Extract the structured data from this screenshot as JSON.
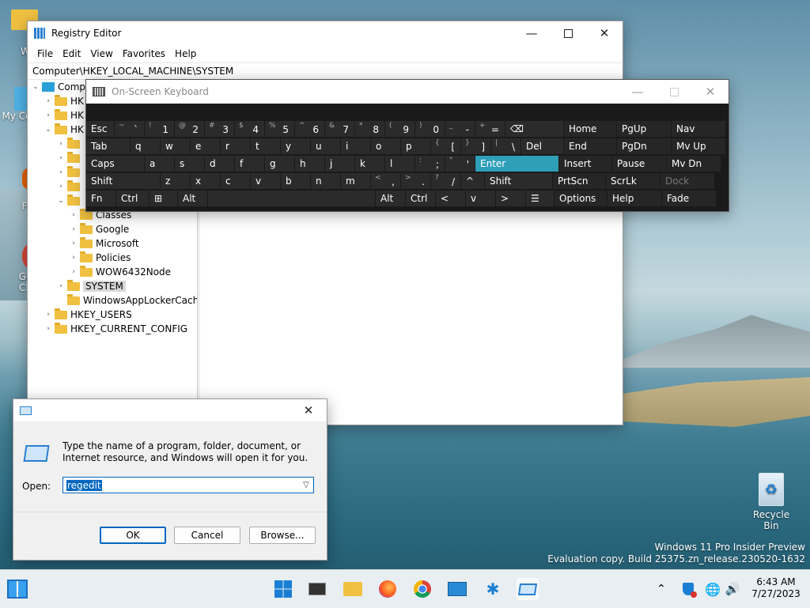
{
  "desktop": {
    "icons": [
      {
        "label": "W",
        "icon": "folder-icon"
      },
      {
        "label": "My Co",
        "icon": "computer-icon"
      },
      {
        "label": "Fi",
        "icon": "firefox-icon"
      },
      {
        "label": "Go",
        "label2": "Ch",
        "icon": "chrome-icon"
      },
      {
        "label": "Recycle Bin",
        "icon": "recycle-bin-icon"
      }
    ],
    "watermark_line1": "Windows 11 Pro Insider Preview",
    "watermark_line2": "Evaluation copy. Build 25375.zn_release.230520-1632"
  },
  "regedit": {
    "title": "Registry Editor",
    "menu": [
      "File",
      "Edit",
      "View",
      "Favorites",
      "Help"
    ],
    "address": "Computer\\HKEY_LOCAL_MACHINE\\SYSTEM",
    "tree": [
      {
        "label": "Comp",
        "level": 0,
        "chev": "v"
      },
      {
        "label": "HK",
        "level": 1,
        "chev": ">"
      },
      {
        "label": "HK",
        "level": 1,
        "chev": ">"
      },
      {
        "label": "HK",
        "level": 1,
        "chev": "v"
      },
      {
        "label": "Classes",
        "level": 3,
        "chev": ">"
      },
      {
        "label": "Google",
        "level": 3,
        "chev": ">"
      },
      {
        "label": "Microsoft",
        "level": 3,
        "chev": ">"
      },
      {
        "label": "Policies",
        "level": 3,
        "chev": ">"
      },
      {
        "label": "WOW6432Node",
        "level": 3,
        "chev": ">"
      },
      {
        "label": "SYSTEM",
        "level": 2,
        "chev": ">",
        "selected": true
      },
      {
        "label": "WindowsAppLockerCache",
        "level": 2,
        "chev": ""
      },
      {
        "label": "HKEY_USERS",
        "level": 1,
        "chev": ">"
      },
      {
        "label": "HKEY_CURRENT_CONFIG",
        "level": 1,
        "chev": ">"
      }
    ]
  },
  "osk": {
    "title": "On-Screen Keyboard",
    "rows": [
      [
        {
          "m": "Esc",
          "w": 36
        },
        {
          "s": "~",
          "m": "`",
          "w": 38
        },
        {
          "s": "!",
          "m": "1",
          "w": 38
        },
        {
          "s": "@",
          "m": "2",
          "w": 38
        },
        {
          "s": "#",
          "m": "3",
          "w": 38
        },
        {
          "s": "$",
          "m": "4",
          "w": 38
        },
        {
          "s": "%",
          "m": "5",
          "w": 38
        },
        {
          "s": "^",
          "m": "6",
          "w": 38
        },
        {
          "s": "&",
          "m": "7",
          "w": 38
        },
        {
          "s": "*",
          "m": "8",
          "w": 38
        },
        {
          "s": "(",
          "m": "9",
          "w": 38
        },
        {
          "s": ")",
          "m": "0",
          "w": 38
        },
        {
          "s": "_",
          "m": "-",
          "w": 38
        },
        {
          "s": "+",
          "m": "=",
          "w": 38
        },
        {
          "m": "⌫",
          "w": 74
        },
        {
          "m": "Home",
          "w": 67,
          "nav": true
        },
        {
          "m": "PgUp",
          "w": 69,
          "nav": true
        },
        {
          "m": "Nav",
          "w": 69,
          "nav": true
        }
      ],
      [
        {
          "m": "Tab",
          "w": 56
        },
        {
          "m": "q",
          "w": 38
        },
        {
          "m": "w",
          "w": 38
        },
        {
          "m": "e",
          "w": 38
        },
        {
          "m": "r",
          "w": 38
        },
        {
          "m": "t",
          "w": 38
        },
        {
          "m": "y",
          "w": 38
        },
        {
          "m": "u",
          "w": 38
        },
        {
          "m": "i",
          "w": 38
        },
        {
          "m": "o",
          "w": 38
        },
        {
          "m": "p",
          "w": 38
        },
        {
          "s": "{",
          "m": "[",
          "w": 38
        },
        {
          "s": "}",
          "m": "]",
          "w": 38
        },
        {
          "s": "|",
          "m": "\\",
          "w": 38
        },
        {
          "m": "Del",
          "w": 54
        },
        {
          "m": "End",
          "w": 67,
          "nav": true
        },
        {
          "m": "PgDn",
          "w": 69,
          "nav": true
        },
        {
          "m": "Mv Up",
          "w": 69,
          "nav": true
        }
      ],
      [
        {
          "m": "Caps",
          "w": 74
        },
        {
          "m": "a",
          "w": 38
        },
        {
          "m": "s",
          "w": 38
        },
        {
          "m": "d",
          "w": 38
        },
        {
          "m": "f",
          "w": 38
        },
        {
          "m": "g",
          "w": 38
        },
        {
          "m": "h",
          "w": 38
        },
        {
          "m": "j",
          "w": 38
        },
        {
          "m": "k",
          "w": 38
        },
        {
          "m": "l",
          "w": 38
        },
        {
          "s": ":",
          "m": ";",
          "w": 38
        },
        {
          "s": "\"",
          "m": "'",
          "w": 38
        },
        {
          "m": "Enter",
          "w": 106,
          "enter": true
        },
        {
          "m": "Insert",
          "w": 67,
          "nav": true
        },
        {
          "m": "Pause",
          "w": 69,
          "nav": true
        },
        {
          "m": "Mv Dn",
          "w": 69,
          "nav": true
        }
      ],
      [
        {
          "m": "Shift",
          "w": 94
        },
        {
          "m": "z",
          "w": 38
        },
        {
          "m": "x",
          "w": 38
        },
        {
          "m": "c",
          "w": 38
        },
        {
          "m": "v",
          "w": 38
        },
        {
          "m": "b",
          "w": 38
        },
        {
          "m": "n",
          "w": 38
        },
        {
          "m": "m",
          "w": 38
        },
        {
          "s": "<",
          "m": ",",
          "w": 38
        },
        {
          "s": ">",
          "m": ".",
          "w": 38
        },
        {
          "s": "?",
          "m": "/",
          "w": 38
        },
        {
          "m": "^",
          "w": 30
        },
        {
          "m": "Shift",
          "w": 86
        },
        {
          "m": "PrtScn",
          "w": 67,
          "nav": true
        },
        {
          "m": "ScrLk",
          "w": 69,
          "nav": true
        },
        {
          "m": "Dock",
          "w": 69,
          "nav": true,
          "dim": true
        }
      ],
      [
        {
          "m": "Fn",
          "w": 38
        },
        {
          "m": "Ctrl",
          "w": 42
        },
        {
          "m": "⊞",
          "w": 36
        },
        {
          "m": "Alt",
          "w": 38
        },
        {
          "m": "",
          "w": 212
        },
        {
          "m": "Alt",
          "w": 38
        },
        {
          "m": "Ctrl",
          "w": 38
        },
        {
          "m": "<",
          "w": 38
        },
        {
          "m": "v",
          "w": 38
        },
        {
          "m": ">",
          "w": 38
        },
        {
          "m": "☰",
          "w": 36
        },
        {
          "m": "Options",
          "w": 67,
          "nav": true
        },
        {
          "m": "Help",
          "w": 69,
          "nav": true
        },
        {
          "m": "Fade",
          "w": 69,
          "nav": true
        }
      ]
    ]
  },
  "run": {
    "description": "Type the name of a program, folder, document, or Internet resource, and Windows will open it for you.",
    "open_label": "Open:",
    "value": "regedit",
    "ok": "OK",
    "cancel": "Cancel",
    "browse": "Browse..."
  },
  "taskbar": {
    "apps": [
      "widgets-icon",
      "start-icon",
      "terminal-icon",
      "file-explorer-icon",
      "firefox-icon",
      "chrome-icon",
      "remote-desktop-icon",
      "settings-gear-icon",
      "run-dialog-icon"
    ],
    "time": "6:43 AM",
    "date": "7/27/2023"
  },
  "colors": {
    "accent": "#0067c0",
    "osk_enter": "#2f9fb8",
    "folder": "#f0c040"
  }
}
